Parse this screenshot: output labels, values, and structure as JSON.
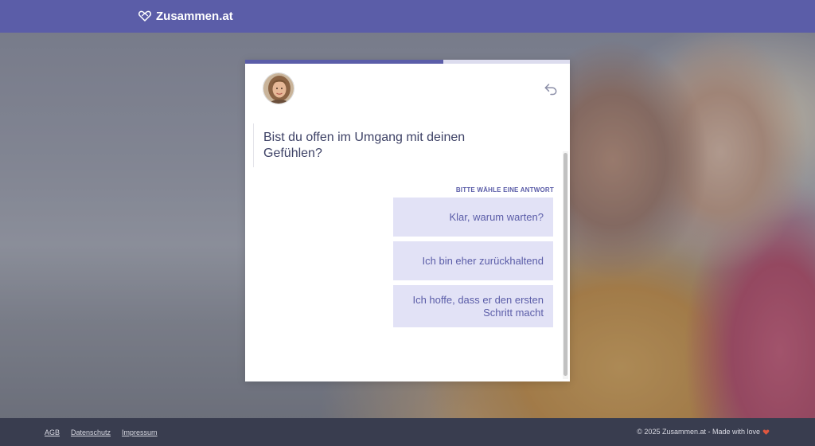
{
  "header": {
    "brand_name": "Zusammen.at",
    "logo_icon": "heart-infinity-icon",
    "background_color": "#5b5da8"
  },
  "quiz": {
    "progress": 0.61,
    "avatar_icon": "user-avatar",
    "back_icon": "undo-arrow-icon",
    "question": "Bist du offen im Umgang mit deinen Gefühlen?",
    "answer_hint": "BITTE WÄHLE EINE ANTWORT",
    "answers": [
      {
        "label": "Klar, warum warten?"
      },
      {
        "label": "Ich bin eher zurückhaltend"
      },
      {
        "label": "Ich hoffe, dass er den ersten Schritt macht"
      }
    ],
    "accent_color": "#5b5da8",
    "answer_bg_color": "#e2e2f6"
  },
  "footer": {
    "links": [
      {
        "label": "AGB"
      },
      {
        "label": "Datenschutz"
      },
      {
        "label": "Impressum"
      }
    ],
    "copyright": "© 2025 Zusammen.at - Made with love",
    "heart_icon": "heart-icon",
    "heart_color": "#e0573f"
  }
}
